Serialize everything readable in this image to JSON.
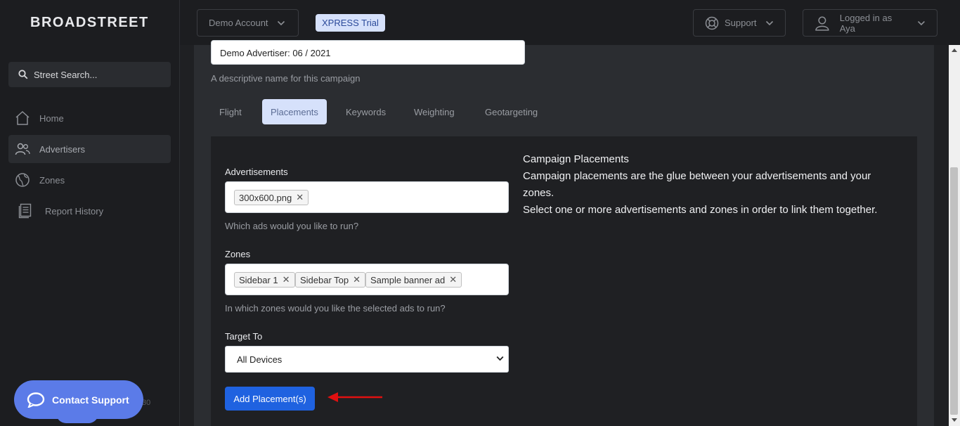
{
  "brand": {
    "logo": "BROADSTREET"
  },
  "sidebar": {
    "search_placeholder": "Street Search...",
    "items": [
      {
        "label": "Home",
        "icon": "home-icon"
      },
      {
        "label": "Advertisers",
        "icon": "users-icon"
      },
      {
        "label": "Zones",
        "icon": "globe-icon"
      },
      {
        "label": "Report History",
        "icon": "report-icon"
      }
    ],
    "contact_label": "Contact Support",
    "partial_text": "30"
  },
  "topbar": {
    "account_label": "Demo Account",
    "trial_badge": "XPRESS Trial",
    "support_label": "Support",
    "user_label": "Logged in as Aya"
  },
  "campaign": {
    "name_value": "Demo Advertiser: 06 / 2021",
    "name_help": "A descriptive name for this campaign"
  },
  "tabs": [
    "Flight",
    "Placements",
    "Keywords",
    "Weighting",
    "Geotargeting"
  ],
  "active_tab": "Placements",
  "placements": {
    "ads_label": "Advertisements",
    "ads": [
      "300x600.png"
    ],
    "ads_help": "Which ads would you like to run?",
    "zones_label": "Zones",
    "zones": [
      "Sidebar 1",
      "Sidebar Top",
      "Sample banner ad"
    ],
    "zones_help": "In which zones would you like the selected ads to run?",
    "target_label": "Target To",
    "target_value": "All Devices",
    "add_button": "Add Placement(s)"
  },
  "info": {
    "title": "Campaign Placements",
    "line1": "Campaign placements are the glue between your advertisements and your zones.",
    "line2": "Select one or more advertisements and zones in order to link them together."
  },
  "colors": {
    "accent": "#1f62e0",
    "annotation_arrow": "#e01010",
    "badge_bg": "#d6e1fb"
  }
}
